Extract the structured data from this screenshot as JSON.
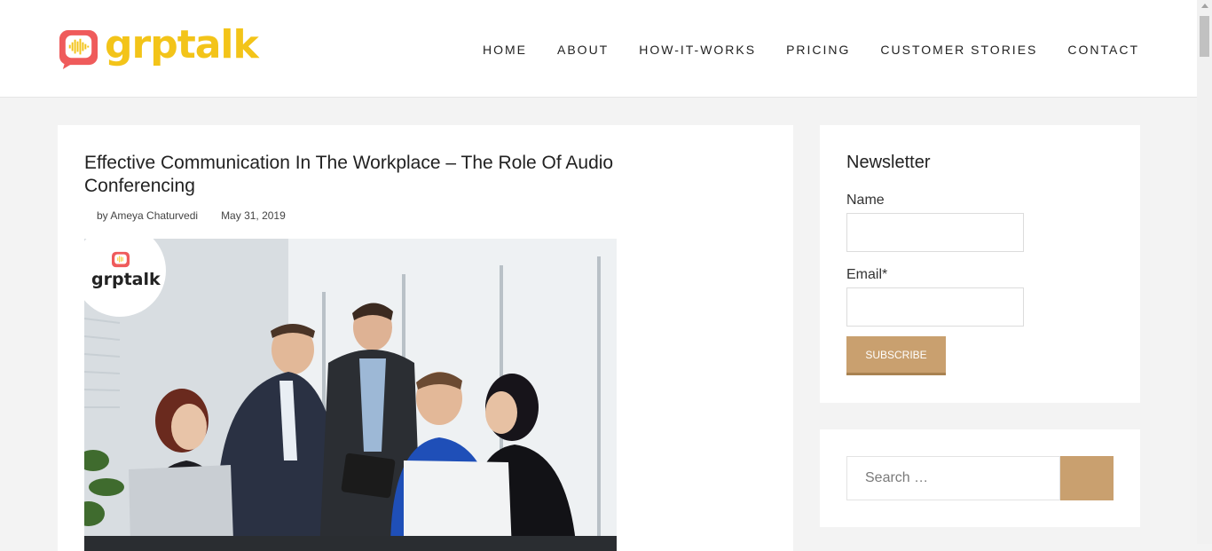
{
  "brand": {
    "name": "grptalk",
    "logo_bg_color": "#ef5b5b",
    "logo_text_color": "#f3c419"
  },
  "nav": {
    "items": [
      {
        "label": "HOME"
      },
      {
        "label": "ABOUT"
      },
      {
        "label": "HOW-IT-WORKS"
      },
      {
        "label": "PRICING"
      },
      {
        "label": "CUSTOMER STORIES"
      },
      {
        "label": "CONTACT"
      }
    ]
  },
  "article": {
    "title": "Effective Communication In The Workplace – The Role Of Audio Conferencing",
    "author": "by Ameya Chaturvedi",
    "date": "May 31, 2019",
    "image_badge_text": "grptalk"
  },
  "newsletter": {
    "title": "Newsletter",
    "name_label": "Name",
    "name_value": "",
    "email_label": "Email*",
    "email_value": "",
    "subscribe_label": "SUBSCRIBE"
  },
  "search": {
    "placeholder": "Search …",
    "value": ""
  },
  "colors": {
    "accent": "#c9a06f",
    "page_bg": "#f3f3f3"
  }
}
